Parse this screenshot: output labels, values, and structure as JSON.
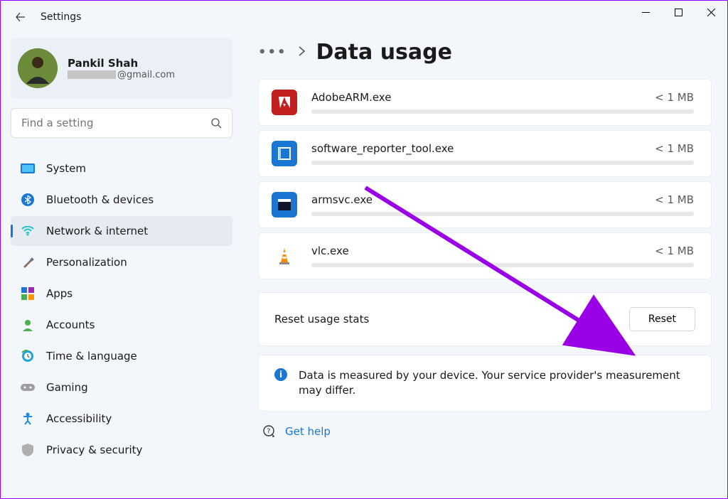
{
  "window": {
    "title": "Settings"
  },
  "profile": {
    "name": "Pankil Shah",
    "email_suffix": "@gmail.com"
  },
  "search": {
    "placeholder": "Find a setting"
  },
  "sidebar": {
    "items": [
      {
        "label": "System",
        "icon": "system"
      },
      {
        "label": "Bluetooth & devices",
        "icon": "bluetooth"
      },
      {
        "label": "Network & internet",
        "icon": "wifi"
      },
      {
        "label": "Personalization",
        "icon": "personalization"
      },
      {
        "label": "Apps",
        "icon": "apps"
      },
      {
        "label": "Accounts",
        "icon": "accounts"
      },
      {
        "label": "Time & language",
        "icon": "time"
      },
      {
        "label": "Gaming",
        "icon": "gaming"
      },
      {
        "label": "Accessibility",
        "icon": "accessibility"
      },
      {
        "label": "Privacy & security",
        "icon": "privacy"
      }
    ],
    "active_index": 2
  },
  "page": {
    "title": "Data usage"
  },
  "apps": [
    {
      "name": "AdobeARM.exe",
      "usage": "< 1 MB",
      "icon": "adobe"
    },
    {
      "name": "software_reporter_tool.exe",
      "usage": "< 1 MB",
      "icon": "software-tool"
    },
    {
      "name": "armsvc.exe",
      "usage": "< 1 MB",
      "icon": "armsvc"
    },
    {
      "name": "vlc.exe",
      "usage": "< 1 MB",
      "icon": "vlc"
    }
  ],
  "reset": {
    "label": "Reset usage stats",
    "button": "Reset"
  },
  "info": {
    "text": "Data is measured by your device. Your service provider's measurement may differ."
  },
  "help": {
    "label": "Get help"
  }
}
